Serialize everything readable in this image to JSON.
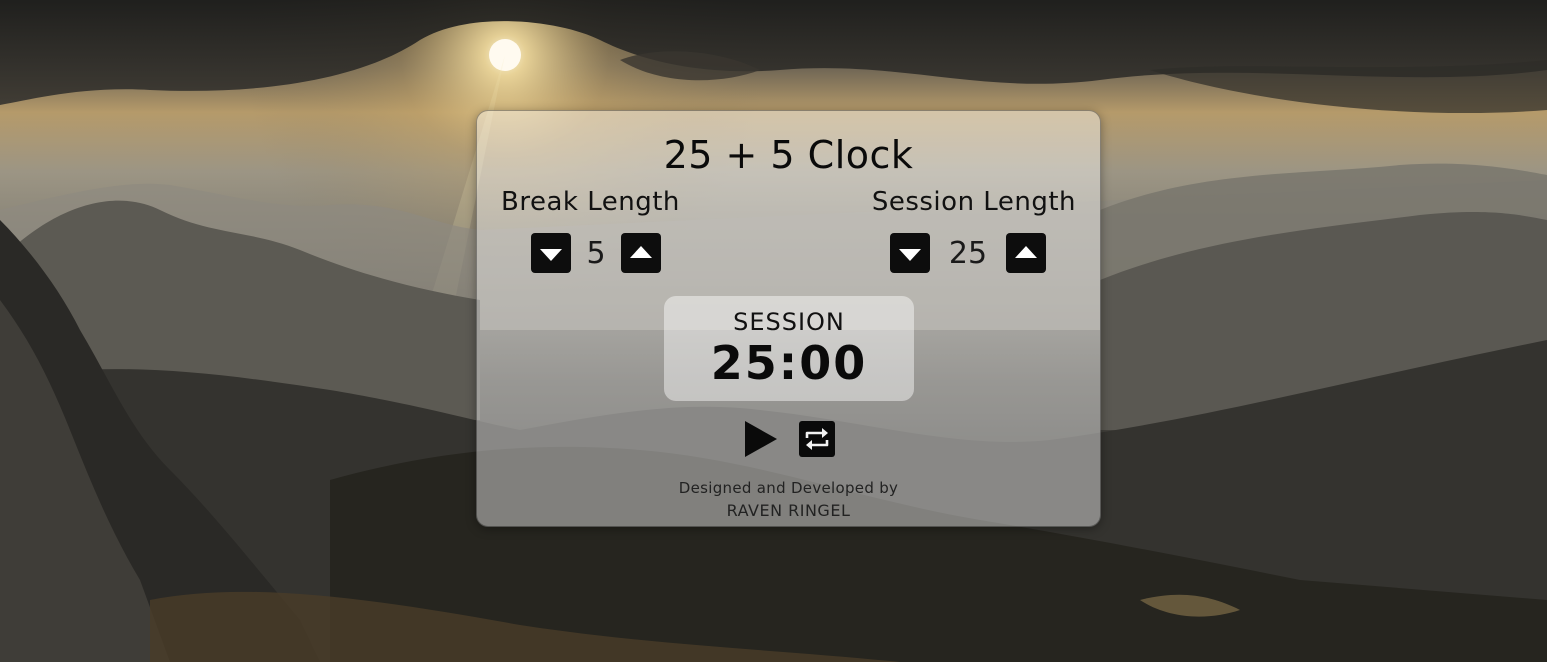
{
  "title": "25 + 5 Clock",
  "break": {
    "label": "Break Length",
    "value": "5"
  },
  "session": {
    "label": "Session Length",
    "value": "25"
  },
  "timer": {
    "mode": "SESSION",
    "time": "25:00"
  },
  "footer": {
    "credit": "Designed and Developed by",
    "author": "RAVEN RINGEL"
  },
  "icons": {
    "decrement": "caret-down-icon",
    "increment": "caret-up-icon",
    "start": "play-icon",
    "reset": "repeat-icon"
  },
  "colors": {
    "button": "#0d0d0d",
    "text": "#111111"
  }
}
